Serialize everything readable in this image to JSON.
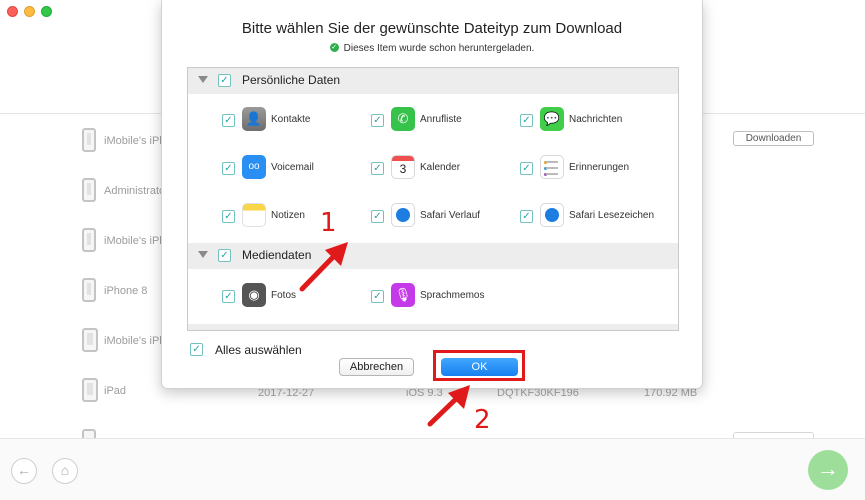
{
  "window": {
    "controls": [
      "close",
      "minimize",
      "maximize"
    ]
  },
  "device_list": {
    "rows": [
      {
        "name": "iMobile's iPh",
        "icon": "phone-icon",
        "date": "",
        "ios": "",
        "serial": "",
        "size": ""
      },
      {
        "name": "Administrato",
        "icon": "phone-icon",
        "date": "",
        "ios": "",
        "serial": "",
        "size": ""
      },
      {
        "name": "iMobile's iPh",
        "icon": "phone-icon",
        "date": "",
        "ios": "",
        "serial": "",
        "size": ""
      },
      {
        "name": "iPhone 8",
        "icon": "phone-icon",
        "date": "",
        "ios": "",
        "serial": "",
        "size": ""
      },
      {
        "name": "iMobile's iPh",
        "icon": "tablet-icon",
        "date": "",
        "ios": "",
        "serial": "",
        "size": ""
      },
      {
        "name": "iPad",
        "icon": "tablet-icon",
        "date": "2017-12-27",
        "ios": "iOS 9.3",
        "serial": "DQTKF30KF196",
        "size": "170.92 MB"
      }
    ],
    "download_button": "Downloaden"
  },
  "dialog": {
    "title": "Bitte wählen Sie der gewünschte Dateityp zum Download",
    "subtitle": "Dieses Item wurde schon heruntergeladen.",
    "sections": [
      {
        "label": "Persönliche Daten",
        "checked": true,
        "items": [
          {
            "label": "Kontakte",
            "icon": "contacts-icon",
            "checked": true
          },
          {
            "label": "Anrufliste",
            "icon": "phone-icon",
            "checked": true
          },
          {
            "label": "Nachrichten",
            "icon": "messages-icon",
            "checked": true
          },
          {
            "label": "Voicemail",
            "icon": "voicemail-icon",
            "checked": true
          },
          {
            "label": "Kalender",
            "icon": "calendar-icon",
            "checked": true,
            "icon_day": "3"
          },
          {
            "label": "Erinnerungen",
            "icon": "reminders-icon",
            "checked": true
          },
          {
            "label": "Notizen",
            "icon": "notes-icon",
            "checked": true
          },
          {
            "label": "Safari Verlauf",
            "icon": "safari-history-icon",
            "checked": true
          },
          {
            "label": "Safari Lesezeichen",
            "icon": "safari-bookmarks-icon",
            "checked": true
          }
        ]
      },
      {
        "label": "Mediendaten",
        "checked": true,
        "items": [
          {
            "label": "Fotos",
            "icon": "camera-icon",
            "checked": true
          },
          {
            "label": "Sprachmemos",
            "icon": "voice-memos-icon",
            "checked": true
          }
        ]
      }
    ],
    "select_all": "Alles auswählen",
    "cancel_button": "Abbrechen",
    "ok_button": "OK"
  },
  "annotations": {
    "step1": "1",
    "step2": "2",
    "color": "#e01a1a"
  },
  "colors": {
    "accent": "#1780f0",
    "checkbox": "#2aa5a0",
    "next": "#9ddf9a"
  }
}
